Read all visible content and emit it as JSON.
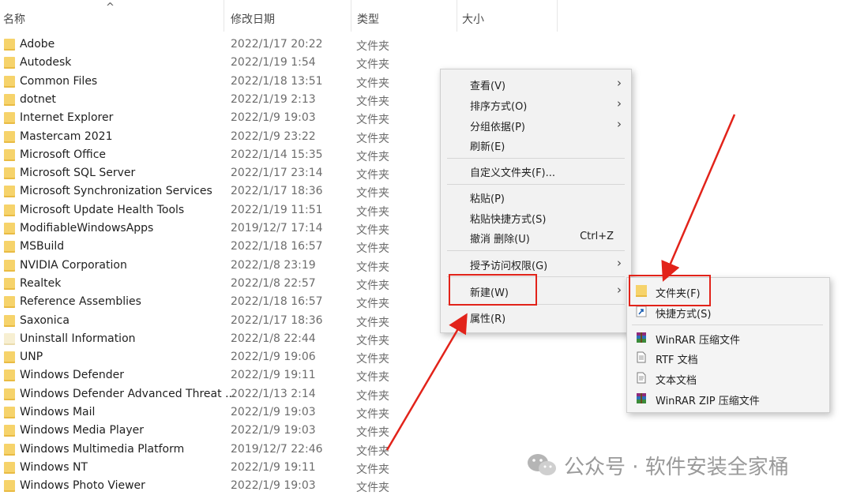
{
  "columns": {
    "name": "名称",
    "modified": "修改日期",
    "type": "类型",
    "size": "大小"
  },
  "files": [
    {
      "name": "Adobe",
      "date": "2022/1/17 20:22",
      "type": "文件夹"
    },
    {
      "name": "Autodesk",
      "date": "2022/1/19 1:54",
      "type": "文件夹"
    },
    {
      "name": "Common Files",
      "date": "2022/1/18 13:51",
      "type": "文件夹"
    },
    {
      "name": "dotnet",
      "date": "2022/1/19 2:13",
      "type": "文件夹"
    },
    {
      "name": "Internet Explorer",
      "date": "2022/1/9 19:03",
      "type": "文件夹"
    },
    {
      "name": "Mastercam 2021",
      "date": "2022/1/9 23:22",
      "type": "文件夹"
    },
    {
      "name": "Microsoft Office",
      "date": "2022/1/14 15:35",
      "type": "文件夹"
    },
    {
      "name": "Microsoft SQL Server",
      "date": "2022/1/17 23:14",
      "type": "文件夹"
    },
    {
      "name": "Microsoft Synchronization Services",
      "date": "2022/1/17 18:36",
      "type": "文件夹"
    },
    {
      "name": "Microsoft Update Health Tools",
      "date": "2022/1/19 11:51",
      "type": "文件夹"
    },
    {
      "name": "ModifiableWindowsApps",
      "date": "2019/12/7 17:14",
      "type": "文件夹"
    },
    {
      "name": "MSBuild",
      "date": "2022/1/18 16:57",
      "type": "文件夹"
    },
    {
      "name": "NVIDIA Corporation",
      "date": "2022/1/8 23:19",
      "type": "文件夹"
    },
    {
      "name": "Realtek",
      "date": "2022/1/8 22:57",
      "type": "文件夹"
    },
    {
      "name": "Reference Assemblies",
      "date": "2022/1/18 16:57",
      "type": "文件夹"
    },
    {
      "name": "Saxonica",
      "date": "2022/1/17 18:36",
      "type": "文件夹"
    },
    {
      "name": "Uninstall Information",
      "date": "2022/1/8 22:44",
      "type": "文件夹"
    },
    {
      "name": "UNP",
      "date": "2022/1/9 19:06",
      "type": "文件夹"
    },
    {
      "name": "Windows Defender",
      "date": "2022/1/9 19:11",
      "type": "文件夹"
    },
    {
      "name": "Windows Defender Advanced Threat ...",
      "date": "2022/1/13 2:14",
      "type": "文件夹"
    },
    {
      "name": "Windows Mail",
      "date": "2022/1/9 19:03",
      "type": "文件夹"
    },
    {
      "name": "Windows Media Player",
      "date": "2022/1/9 19:03",
      "type": "文件夹"
    },
    {
      "name": "Windows Multimedia Platform",
      "date": "2019/12/7 22:46",
      "type": "文件夹"
    },
    {
      "name": "Windows NT",
      "date": "2022/1/9 19:11",
      "type": "文件夹"
    },
    {
      "name": "Windows Photo Viewer",
      "date": "2022/1/9 19:03",
      "type": "文件夹"
    }
  ],
  "context_menu": {
    "view": "查看(V)",
    "sort_by": "排序方式(O)",
    "group_by": "分组依据(P)",
    "refresh": "刷新(E)",
    "customize": "自定义文件夹(F)...",
    "paste": "粘贴(P)",
    "paste_shortcut": "粘贴快捷方式(S)",
    "undo_delete": "撤消 删除(U)",
    "undo_shortcut": "Ctrl+Z",
    "grant_access": "授予访问权限(G)",
    "new": "新建(W)",
    "properties": "属性(R)"
  },
  "new_submenu": {
    "folder": "文件夹(F)",
    "shortcut": "快捷方式(S)",
    "winrar_archive": "WinRAR 压缩文件",
    "rtf_doc": "RTF 文档",
    "text_doc": "文本文档",
    "winrar_zip": "WinRAR ZIP 压缩文件"
  },
  "watermark": "公众号 · 软件安装全家桶",
  "colors": {
    "folder": "#f6d36b",
    "highlight": "#e2231a",
    "arrow": "#e2231a",
    "menu_bg": "#f2f2f2"
  }
}
